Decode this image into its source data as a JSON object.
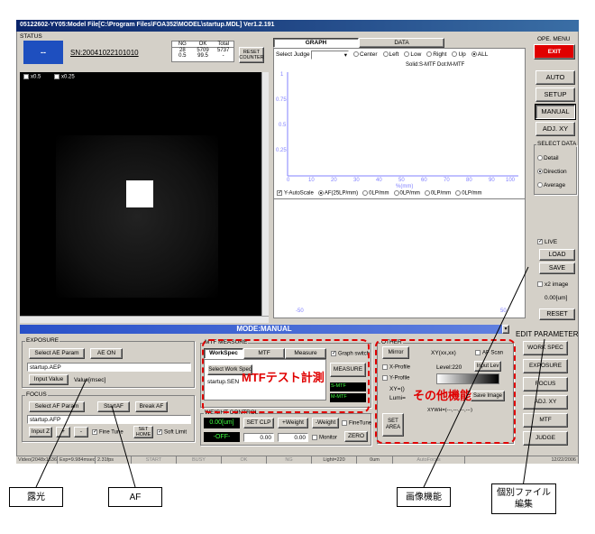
{
  "title": "05122602-YY05:Model File[C:\\Program Files\\FOA352\\MODEL\\startup.MDL] Ver1.2.191",
  "status": {
    "label": "STATUS",
    "indicator": "--",
    "sn": "SN:20041022101010",
    "ng_hdr": "NG",
    "ok_hdr": "OK",
    "total_hdr": "Total",
    "ng_val": "28",
    "ok_val": "5709",
    "total_val": "5737",
    "ng_pct": "0.5",
    "ok_pct": "99.5",
    "total_pct": "-",
    "reset_counter": "RESET COUNTER"
  },
  "image_panel": {
    "chk1": "x0.5",
    "chk2": "x0.25"
  },
  "graph": {
    "tab_graph": "GRAPH",
    "tab_data": "DATA",
    "select_judge": "Select Judge",
    "radios": [
      "Center",
      "Left",
      "Low",
      "Right",
      "Up",
      "ALL"
    ],
    "legend": "Solid:S-MTF  Dot:M-MTF",
    "yticks": [
      "1",
      "0.75",
      "0.5",
      "0.25",
      "0"
    ],
    "xticks": [
      "0",
      "10",
      "20",
      "30",
      "40",
      "50",
      "60",
      "70",
      "80",
      "90",
      "100"
    ],
    "xunit": "%(mm)",
    "autoscale": "Y-AutoScale",
    "freq": [
      "AF(25LP/mm)",
      "0LP/mm",
      "0LP/mm",
      "0LP/mm",
      "0LP/mm"
    ],
    "lower_left": "-50",
    "lower_right": "50"
  },
  "ope_menu": {
    "label": "OPE. MENU",
    "exit": "EXIT",
    "auto": "AUTO",
    "setup": "SETUP",
    "manual": "MANUAL",
    "adjxy": "ADJ. XY",
    "select_data": "SELECT DATA",
    "detail": "Detail",
    "direction": "Direction",
    "average": "Average",
    "live": "LIVE",
    "load": "LOAD",
    "save": "SAVE",
    "x2image": "x2 image",
    "um": "0.00[um]",
    "reset": "RESET"
  },
  "mode_bar": "MODE:MANUAL",
  "exposure": {
    "label": "EXPOSURE",
    "select": "Select AE Param",
    "aeon": "AE ON",
    "file": "startup.AEP",
    "input": "Input Value",
    "msec": "Value[msec]"
  },
  "focus": {
    "label": "FOCUS",
    "select": "Select AF Param",
    "start": "StartAF",
    "break": "Break AF",
    "file": "startup.AFP",
    "inputz": "Input Z",
    "plus": "+",
    "minus": "-",
    "finetune": "Fine Tune",
    "sethome": "SET HOME",
    "softlimit": "Soft Limit"
  },
  "mtf": {
    "label": "MTF MEASURE",
    "tab_ws": "WorkSpec",
    "tab_mtf": "MTF",
    "tab_measure": "Measure",
    "graph_switch": "Graph switch",
    "select_ws": "Select Work Spec",
    "file": "startup.SEN",
    "measure": "MEASURE",
    "s_mtf": "S-MTF",
    "m_mtf": "M-MTF",
    "annotation": "MTFテスト計測"
  },
  "weight": {
    "label": "WEIGHT CONTROL",
    "um": "0.00[um]",
    "setclp": "SET CLP",
    "pweight": "+Weight",
    "mweight": "-Weight",
    "finetune": "FineTune",
    "off": "-OFF-",
    "v1": "0.00",
    "v2": "0.00",
    "monitor": "Monitor",
    "zero": "ZERO"
  },
  "other": {
    "label": "OTHER",
    "mirror": "Mirror",
    "xy": "XY(xx,xx)",
    "afscan": "AF Scan",
    "xprofile": "X-Profile",
    "level": "Level:220",
    "inputlv": "Input Lev",
    "yprofile": "Y-Profile",
    "xyo": "XY=()",
    "lumi": "Lumi=",
    "saveimg": "Save Image",
    "seta": "SET AREA",
    "xyww": "XYWH=(---,---,---,---)",
    "annotation": "その他機能"
  },
  "edit": {
    "label": "EDIT PARAMETER",
    "items": [
      "WORK SPEC",
      "EXPOSURE",
      "FOCUS",
      "ADJ. XY",
      "MTF",
      "JUDGE"
    ]
  },
  "statusbar": [
    "Video(2048x1536)",
    "Exp=9.984msec",
    "2.31fps",
    "START",
    "BUSY",
    "OK",
    "NG",
    "Light=220",
    "0um",
    "AutoFocus",
    "12/22/2006"
  ],
  "callouts": {
    "exposure": "露光",
    "af": "AF",
    "image": "画像機能",
    "individual": "個別ファイル\n編集"
  }
}
